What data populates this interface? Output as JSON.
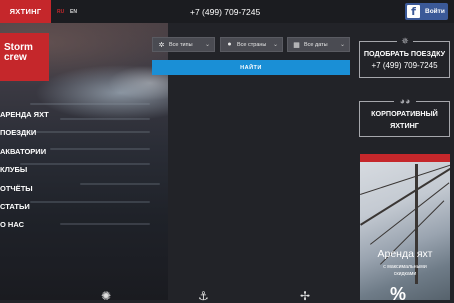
{
  "topbar": {
    "yacht_tab": "ЯХТИНГ",
    "lang_ru": "RU",
    "lang_en": "EN",
    "phone": "+7 (499) 709-7245",
    "fb_logo": "f",
    "fb_login": "Войти"
  },
  "logo": {
    "line1": "Storm",
    "line2": "crew"
  },
  "menu": {
    "items": [
      "АРЕНДА ЯХТ",
      "ПОЕЗДКИ",
      "АКВАТОРИИ",
      "КЛУБЫ",
      "ОТЧЁТЫ",
      "СТАТЬИ",
      "О НАС"
    ]
  },
  "search": {
    "types": "Все типы",
    "countries": "Все страны",
    "dates": "Все даты",
    "find": "НАЙТИ"
  },
  "sidebar": {
    "trip_card": {
      "line1": "ПОДОБРАТЬ ПОЕЗДКУ",
      "line2": "+7 (499) 709-7245"
    },
    "corp_card": {
      "line1": "КОРПОРАТИВНЫЙ",
      "line2": "ЯХТИНГ"
    },
    "ad": {
      "title": "Аренда яхт",
      "sub1": "с максимальными",
      "sub2": "скидками",
      "percent": "%"
    }
  },
  "icons": {
    "types": "gear-wheel-icon",
    "countries": "map-pin-icon",
    "dates": "calendar-icon",
    "trip": "steering-wheel-icon",
    "corp": "sunglasses-icon"
  },
  "colors": {
    "brand_red": "#c5272b",
    "accent_blue": "#1a8fd6",
    "facebook": "#3b5998",
    "background": "#222328"
  }
}
